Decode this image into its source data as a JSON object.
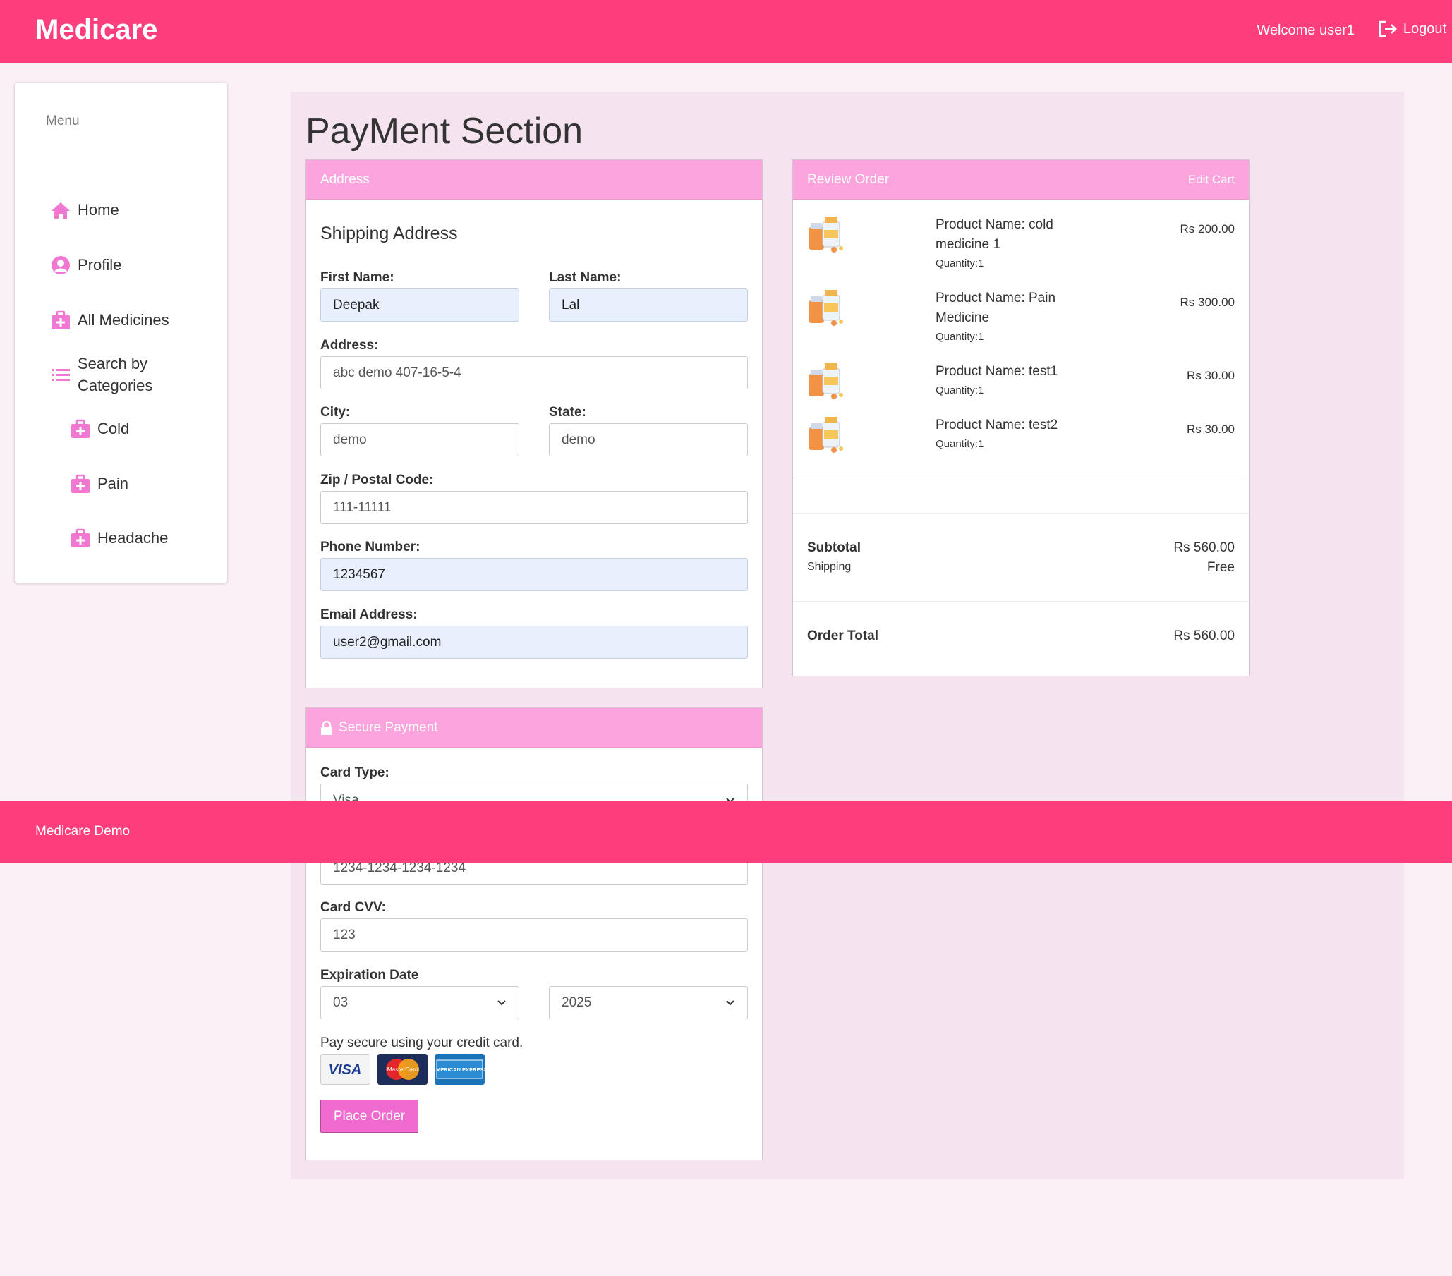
{
  "header": {
    "brand": "Medicare",
    "welcome": "Welcome user1",
    "logout": "Logout",
    "color": "#fe3e7c"
  },
  "sidebar": {
    "title": "Menu",
    "items": [
      {
        "label": "Home",
        "icon": "home-icon"
      },
      {
        "label": "Profile",
        "icon": "user-circle-icon"
      },
      {
        "label": "All Medicines",
        "icon": "medical-kit-icon"
      },
      {
        "label": "Search by Categories",
        "icon": "list-icon"
      },
      {
        "label": "Cold",
        "icon": "medical-kit-icon"
      },
      {
        "label": "Pain",
        "icon": "medical-kit-icon"
      },
      {
        "label": "Headache",
        "icon": "medical-kit-icon"
      }
    ]
  },
  "page": {
    "title": "PayMent Section"
  },
  "address": {
    "heading": "Address",
    "subheading": "Shipping Address",
    "first_name": {
      "label": "First Name:",
      "value": "Deepak"
    },
    "last_name": {
      "label": "Last Name:",
      "value": "Lal"
    },
    "address": {
      "label": "Address:",
      "value": "abc demo 407-16-5-4"
    },
    "city": {
      "label": "City:",
      "value": "demo"
    },
    "state": {
      "label": "State:",
      "value": "demo"
    },
    "zip": {
      "label": "Zip / Postal Code:",
      "value": "111-11111"
    },
    "phone": {
      "label": "Phone Number:",
      "value": "1234567"
    },
    "email": {
      "label": "Email Address:",
      "value": "user2@gmail.com"
    }
  },
  "review": {
    "heading": "Review Order",
    "edit_cart": "Edit Cart",
    "items": [
      {
        "name": "Product Name: cold medicine 1",
        "qty": "Quantity:1",
        "price": "Rs 200.00"
      },
      {
        "name": "Product Name: Pain Medicine",
        "qty": "Quantity:1",
        "price": "Rs 300.00"
      },
      {
        "name": "Product Name: test1",
        "qty": "Quantity:1",
        "price": "Rs 30.00"
      },
      {
        "name": "Product Name: test2",
        "qty": "Quantity:1",
        "price": "Rs 30.00"
      }
    ],
    "subtotal_label": "Subtotal",
    "subtotal_value": "Rs 560.00",
    "shipping_label": "Shipping",
    "shipping_value": "Free",
    "total_label": "Order Total",
    "total_value": "Rs 560.00"
  },
  "payment": {
    "heading": "Secure Payment",
    "card_type": {
      "label": "Card Type:",
      "value": "Visa"
    },
    "card_number": {
      "value": "1234-1234-1234-1234"
    },
    "cvv": {
      "label": "Card CVV:",
      "value": "123"
    },
    "expiration": {
      "label": "Expiration Date",
      "month": "03",
      "year": "2025"
    },
    "note": "Pay secure using your credit card.",
    "cards": [
      {
        "name": "visa-logo",
        "text": "VISA"
      },
      {
        "name": "mastercard-logo",
        "text": "MasterCard"
      },
      {
        "name": "amex-logo",
        "text": "AMERICAN EXPRESS"
      }
    ],
    "place_order": "Place Order"
  },
  "footer": {
    "text": "Medicare Demo"
  }
}
